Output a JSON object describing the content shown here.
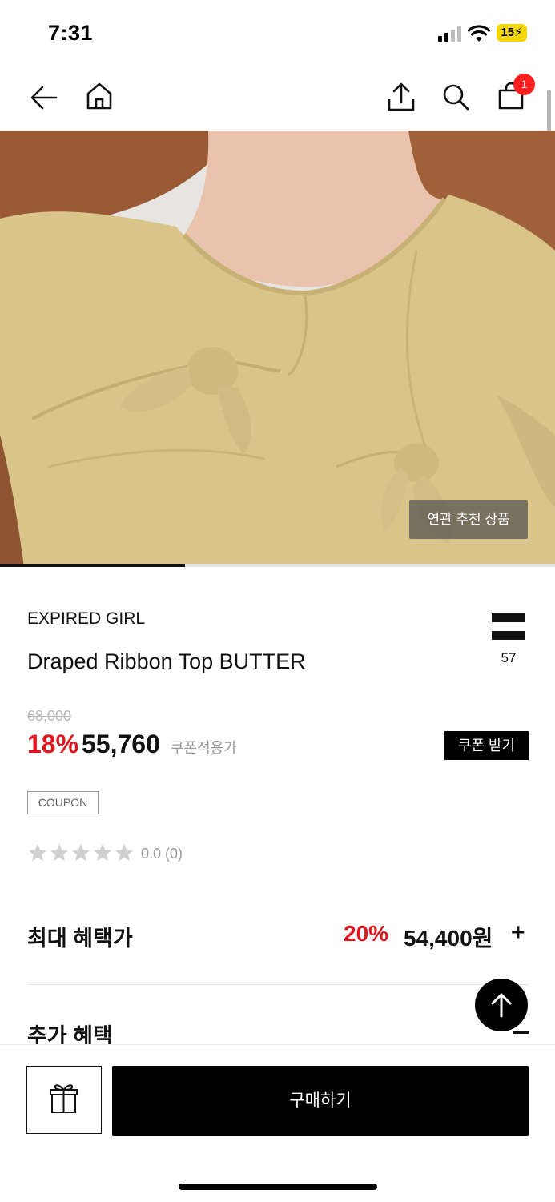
{
  "status_bar": {
    "time": "7:31",
    "battery": "15",
    "icons": [
      "signal-icon",
      "wifi-icon",
      "battery-icon"
    ]
  },
  "nav": {
    "icons": [
      "back-arrow-icon",
      "home-icon",
      "share-icon",
      "search-icon",
      "cart-icon"
    ],
    "cart_count": "1"
  },
  "hero": {
    "recommend_label": "연관 추천 상품",
    "progress_fraction": 0.333
  },
  "product": {
    "brand": "EXPIRED GIRL",
    "title": "Draped Ribbon Top BUTTER",
    "like_count": "57",
    "original_price": "68,000",
    "discount": "18%",
    "price": "55,760",
    "coupon_note": "쿠폰적용가",
    "coupon_button": "쿠폰 받기",
    "coupon_tag": "COUPON",
    "rating_text": "0.0 (0)",
    "rating_stars": 0
  },
  "benefits": {
    "max_label": "최대 혜택가",
    "max_discount": "20%",
    "max_price": "54,400원",
    "expand_symbol": "+",
    "extra_label": "추가 혜택"
  },
  "bottom_bar": {
    "buy_label": "구매하기"
  },
  "colors": {
    "accent_red": "#e0161f",
    "badge_red": "#ff1f1f",
    "battery_yellow": "#f5d60a",
    "garment": "#d9c489"
  }
}
